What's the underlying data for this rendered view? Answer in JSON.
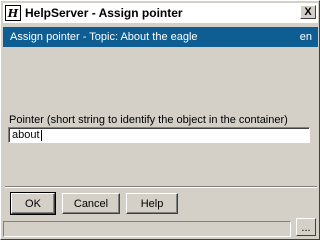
{
  "window": {
    "title": "HelpServer - Assign pointer",
    "app_icon_glyph": "H",
    "close_glyph": "X"
  },
  "header": {
    "text": "Assign pointer - Topic: About the eagle",
    "lang": "en"
  },
  "form": {
    "pointer_label": "Pointer (short string to identify the object in the container)",
    "pointer_value": "about"
  },
  "buttons": {
    "ok": "OK",
    "cancel": "Cancel",
    "help": "Help"
  },
  "statusbar": {
    "more_label": "..."
  },
  "colors": {
    "header_band": "#0e5e93",
    "dialog_face": "#d4d0c8"
  },
  "icons": [
    "app-icon",
    "close-icon"
  ]
}
